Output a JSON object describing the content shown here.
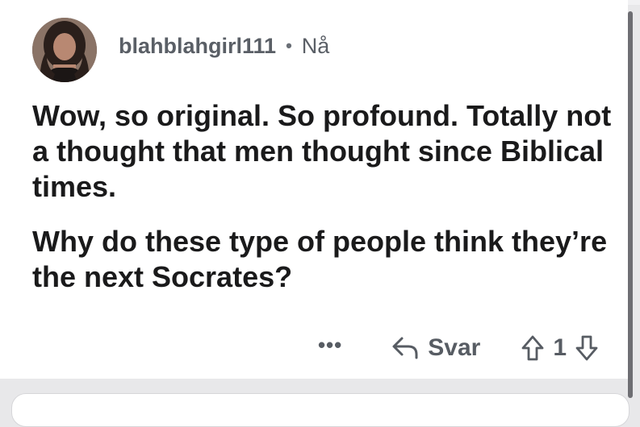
{
  "comment": {
    "username": "blahblahgirl111",
    "separator": "•",
    "timestamp": "Nå",
    "paragraphs": [
      "Wow, so original. So profound. Totally not a thought that men thought since Biblical times.",
      "Why do these type of people think they’re the next Socrates?"
    ]
  },
  "actions": {
    "more_label": "•••",
    "reply_label": "Svar",
    "vote_count": "1",
    "icons": {
      "reply": "reply-arrow-icon",
      "upvote": "upvote-arrow-icon",
      "downvote": "downvote-arrow-icon"
    }
  },
  "colors": {
    "background": "#ffffff",
    "text": "#1a1a1b",
    "meta": "#5a5f66"
  }
}
